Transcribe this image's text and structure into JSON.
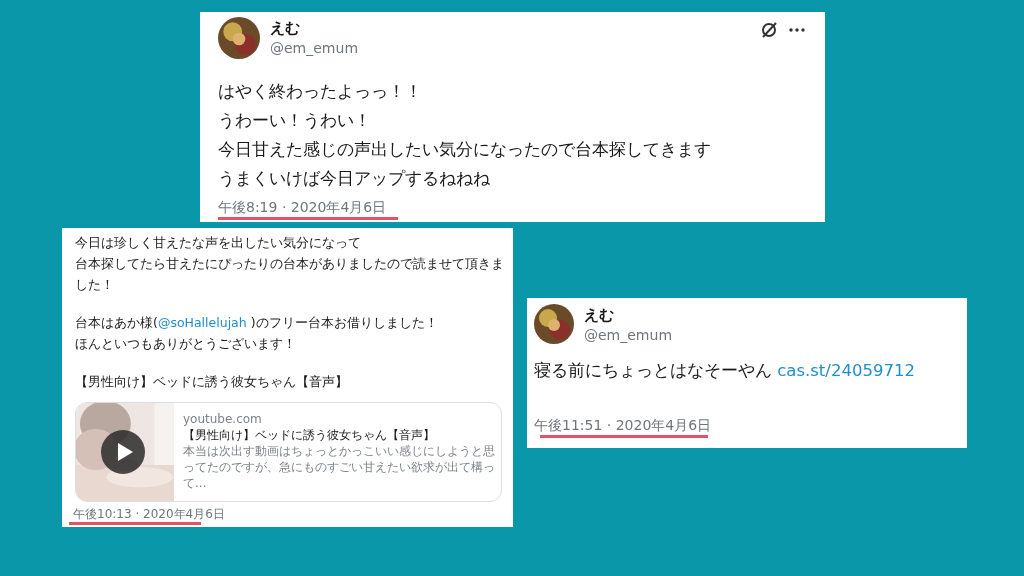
{
  "tweets": [
    {
      "author": {
        "name": "えむ",
        "handle": "@em_emum"
      },
      "actions": [
        {
          "kind": "no-entry"
        },
        {
          "kind": "more"
        }
      ],
      "body": [
        {
          "lines": [
            {
              "text": "はやく終わったよっっ！！"
            },
            {
              "text": "うわーい！うわい！"
            },
            {
              "text": "今日甘えた感じの声出したい気分になったので台本探してきます"
            },
            {
              "text": "うまくいけば今日アップするねねね"
            }
          ]
        }
      ],
      "timestamp": "午後8:19 · 2020年4月6日",
      "underlined": true
    },
    {
      "body": [
        {
          "lines": [
            {
              "text": "今日は珍しく甘えたな声を出したい気分になって"
            },
            {
              "text": "台本探してたら甘えたにぴったりの台本がありましたので読ませて頂きました！"
            }
          ]
        },
        {
          "lines": [
            {
              "text": "台本はあか様(",
              "link": "@soHallelujah",
              "after": " )のフリー台本お借りしました！"
            },
            {
              "text": "ほんといつもありがとうございます！"
            }
          ]
        },
        {
          "lines": [
            {
              "text": "【男性向け】ベッドに誘う彼女ちゃん【音声】"
            }
          ]
        }
      ],
      "card": {
        "domain": "youtube.com",
        "title": "【男性向け】ベッドに誘う彼女ちゃん【音声】",
        "description": "本当は次出す動画はちょっとかっこいい感じにしようと思ってたのですが、急にものすごい甘えたい欲求が出て構って..."
      },
      "timestamp": "午後10:13 · 2020年4月6日",
      "underlined": true
    },
    {
      "author": {
        "name": "えむ",
        "handle": "@em_emum"
      },
      "body": [
        {
          "lines": [
            {
              "text": "寝る前にちょっとはなそーやん ",
              "link": "cas.st/24059712"
            }
          ]
        }
      ],
      "timestamp": "午後11:51 · 2020年4月6日",
      "underlined": true
    }
  ]
}
